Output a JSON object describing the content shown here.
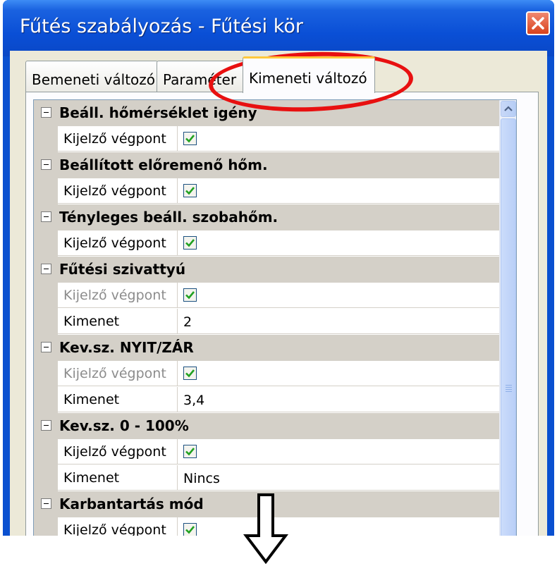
{
  "window": {
    "title": "Fűtés szabályozás - Fűtési kör"
  },
  "tabs": [
    {
      "label": "Bemeneti változó",
      "active": false
    },
    {
      "label": "Paraméter",
      "active": false
    },
    {
      "label": "Kimeneti változó",
      "active": true
    }
  ],
  "sections": [
    {
      "title": "Beáll. hőmérséklet igény",
      "rows": [
        {
          "name": "Kijelző végpont",
          "type": "checkbox",
          "checked": true,
          "disabled": false
        }
      ]
    },
    {
      "title": "Beállított előremenő hőm.",
      "rows": [
        {
          "name": "Kijelző végpont",
          "type": "checkbox",
          "checked": true,
          "disabled": false
        }
      ]
    },
    {
      "title": "Tényleges beáll. szobahőm.",
      "rows": [
        {
          "name": "Kijelző végpont",
          "type": "checkbox",
          "checked": true,
          "disabled": false
        }
      ]
    },
    {
      "title": "Fűtési szivattyú",
      "rows": [
        {
          "name": "Kijelző végpont",
          "type": "checkbox",
          "checked": true,
          "disabled": true
        },
        {
          "name": "Kimenet",
          "type": "text",
          "value": "2"
        }
      ]
    },
    {
      "title": "Kev.sz. NYIT/ZÁR",
      "rows": [
        {
          "name": "Kijelző végpont",
          "type": "checkbox",
          "checked": true,
          "disabled": true
        },
        {
          "name": "Kimenet",
          "type": "text",
          "value": "3,4"
        }
      ]
    },
    {
      "title": "Kev.sz. 0 - 100%",
      "rows": [
        {
          "name": "Kijelző végpont",
          "type": "checkbox",
          "checked": true,
          "disabled": false
        },
        {
          "name": "Kimenet",
          "type": "text",
          "value": "Nincs"
        }
      ]
    },
    {
      "title": "Karbantartás mód",
      "rows": [
        {
          "name": "Kijelző végpont",
          "type": "checkbox",
          "checked": true,
          "disabled": false
        }
      ]
    }
  ],
  "colors": {
    "titlebar": "#0a4fd6",
    "section_bg": "#d4d0c8",
    "annotation_ellipse": "#e81010",
    "checkmark": "#21a121"
  },
  "icons": {
    "close": "close-icon",
    "scroll_up": "chevron-up-icon",
    "collapse": "minus-icon",
    "annotation": "down-arrow-icon"
  }
}
